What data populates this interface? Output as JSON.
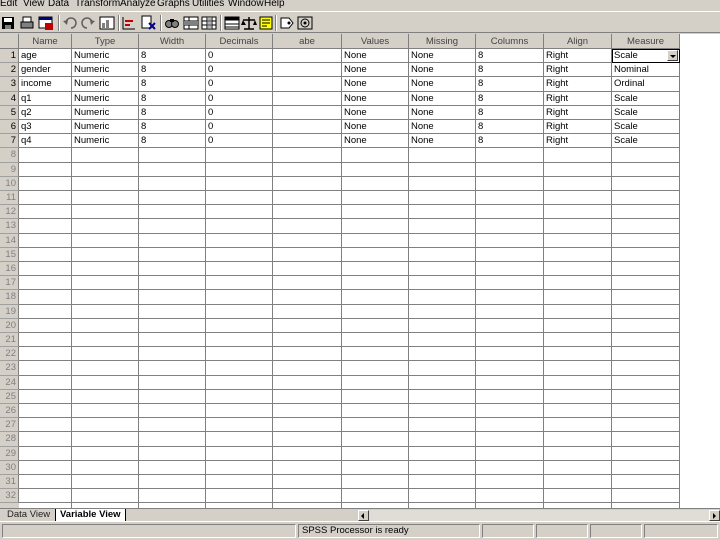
{
  "menu": [
    "Edit",
    "View",
    "Data",
    "Transform",
    "Analyze",
    "Graphs",
    "Utilities",
    "Window",
    "Help"
  ],
  "toolbar_icons": [
    "save-icon",
    "print-icon",
    "dialog-recall-icon",
    "undo-icon",
    "redo-icon",
    "goto-chart-icon",
    "goto-case-icon",
    "variables-icon",
    "find-icon",
    "insert-case-icon",
    "insert-variable-icon",
    "split-file-icon",
    "weight-cases-icon",
    "select-cases-icon",
    "value-labels-icon",
    "use-sets-icon"
  ],
  "grid": {
    "columns": [
      "Name",
      "Type",
      "Width",
      "Decimals",
      "abe",
      "Values",
      "Missing",
      "Columns",
      "Align",
      "Measure"
    ],
    "rows": [
      [
        "age",
        "Numeric",
        "8",
        "0",
        "",
        "None",
        "None",
        "8",
        "Right",
        "Scale"
      ],
      [
        "gender",
        "Numeric",
        "8",
        "0",
        "",
        "None",
        "None",
        "8",
        "Right",
        "Nominal"
      ],
      [
        "income",
        "Numeric",
        "8",
        "0",
        "",
        "None",
        "None",
        "8",
        "Right",
        "Ordinal"
      ],
      [
        "q1",
        "Numeric",
        "8",
        "0",
        "",
        "None",
        "None",
        "8",
        "Right",
        "Scale"
      ],
      [
        "q2",
        "Numeric",
        "8",
        "0",
        "",
        "None",
        "None",
        "8",
        "Right",
        "Scale"
      ],
      [
        "q3",
        "Numeric",
        "8",
        "0",
        "",
        "None",
        "None",
        "8",
        "Right",
        "Scale"
      ],
      [
        "q4",
        "Numeric",
        "8",
        "0",
        "",
        "None",
        "None",
        "8",
        "Right",
        "Scale"
      ]
    ],
    "row_numbers": [
      "1",
      "2",
      "3",
      "4",
      "5",
      "6",
      "7",
      "8",
      "9",
      "10",
      "11",
      "12",
      "13",
      "14",
      "15",
      "16",
      "17",
      "18",
      "19",
      "20",
      "21",
      "22",
      "23",
      "24",
      "25",
      "26",
      "27",
      "28",
      "29",
      "30",
      "31",
      "32"
    ]
  },
  "tabs": [
    "Data View",
    "Variable View"
  ],
  "status": "SPSS Processor is ready"
}
